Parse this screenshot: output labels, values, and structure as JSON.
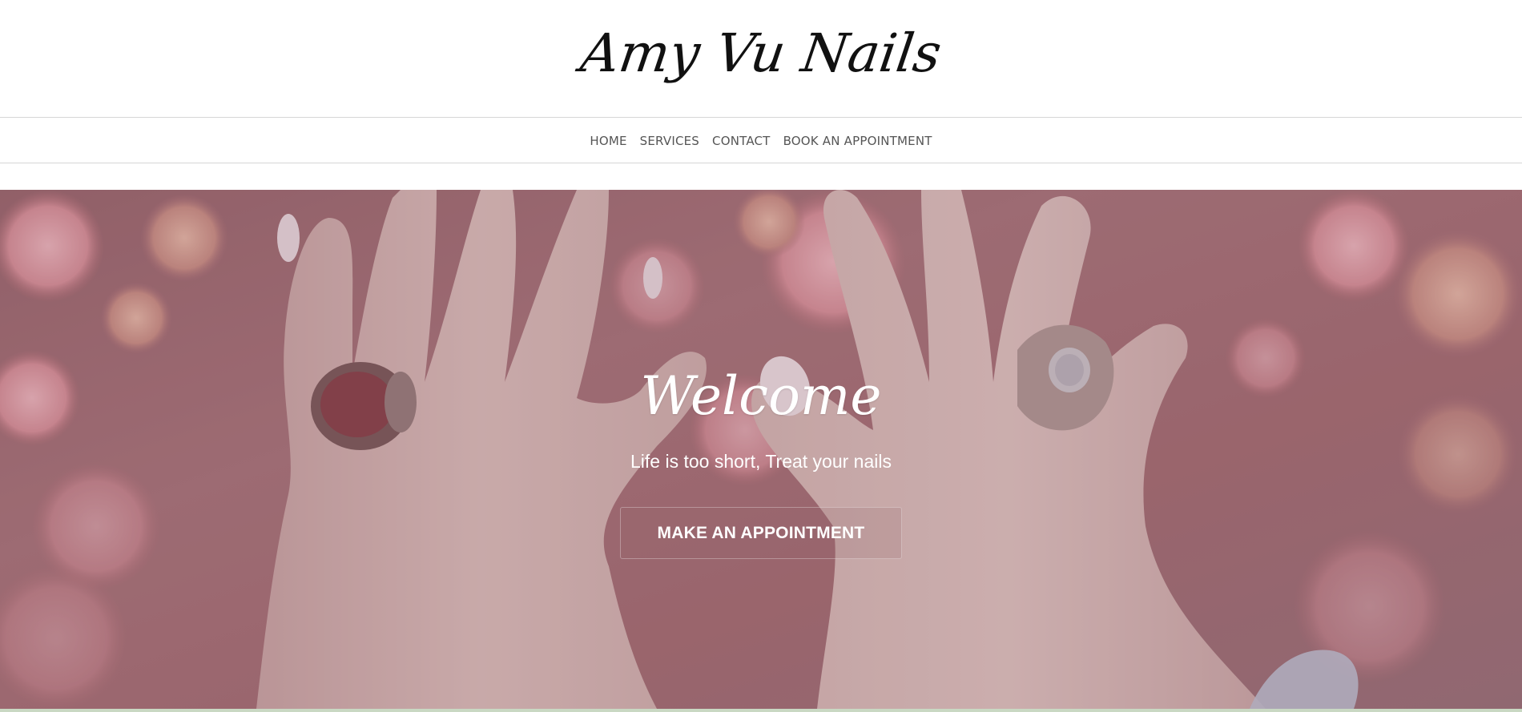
{
  "header": {
    "logo_text": "Amy Vu Nails"
  },
  "nav": {
    "items": [
      {
        "label": "HOME"
      },
      {
        "label": "SERVICES"
      },
      {
        "label": "CONTACT"
      },
      {
        "label": "BOOK AN APPOINTMENT"
      }
    ]
  },
  "hero": {
    "title": "Welcome",
    "subtitle": "Life is too short, Treat your nails",
    "cta_label": "MAKE AN APPOINTMENT",
    "image_icon": "hands-with-rings-and-flowers-photo"
  },
  "colors": {
    "nav_text": "#555555",
    "divider": "#d6d6d6",
    "hero_tint": "#9b6f76",
    "accent_bottom": "#c9d8c3"
  }
}
